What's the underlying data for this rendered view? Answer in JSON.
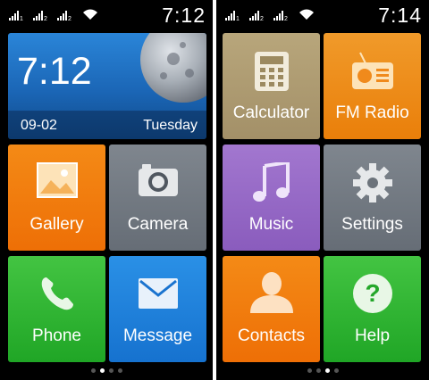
{
  "screens": [
    {
      "status": {
        "time": "7:12",
        "sim1": "1",
        "sim2": "2"
      },
      "clock_widget": {
        "time": "7:12",
        "date": "09-02",
        "weekday": "Tuesday"
      },
      "tiles": [
        {
          "label": "Gallery",
          "icon": "gallery-icon"
        },
        {
          "label": "Camera",
          "icon": "camera-icon"
        },
        {
          "label": "Phone",
          "icon": "phone-icon"
        },
        {
          "label": "Message",
          "icon": "message-icon"
        }
      ],
      "page_indicator": {
        "count": 4,
        "active": 1
      }
    },
    {
      "status": {
        "time": "7:14",
        "sim1": "1",
        "sim2": "2"
      },
      "tiles": [
        {
          "label": "Calculator",
          "icon": "calculator-icon"
        },
        {
          "label": "FM Radio",
          "icon": "radio-icon"
        },
        {
          "label": "Music",
          "icon": "music-icon"
        },
        {
          "label": "Settings",
          "icon": "gear-icon"
        },
        {
          "label": "Contacts",
          "icon": "contacts-icon"
        },
        {
          "label": "Help",
          "icon": "help-icon"
        }
      ],
      "page_indicator": {
        "count": 4,
        "active": 2
      }
    }
  ],
  "colors": {
    "orange": "#f07c0e",
    "gray": "#737a82",
    "green": "#2fb334",
    "blue": "#1f82dc",
    "khaki": "#ad9b72",
    "purple": "#9669c6",
    "clock_blue": "#1b66b6"
  }
}
